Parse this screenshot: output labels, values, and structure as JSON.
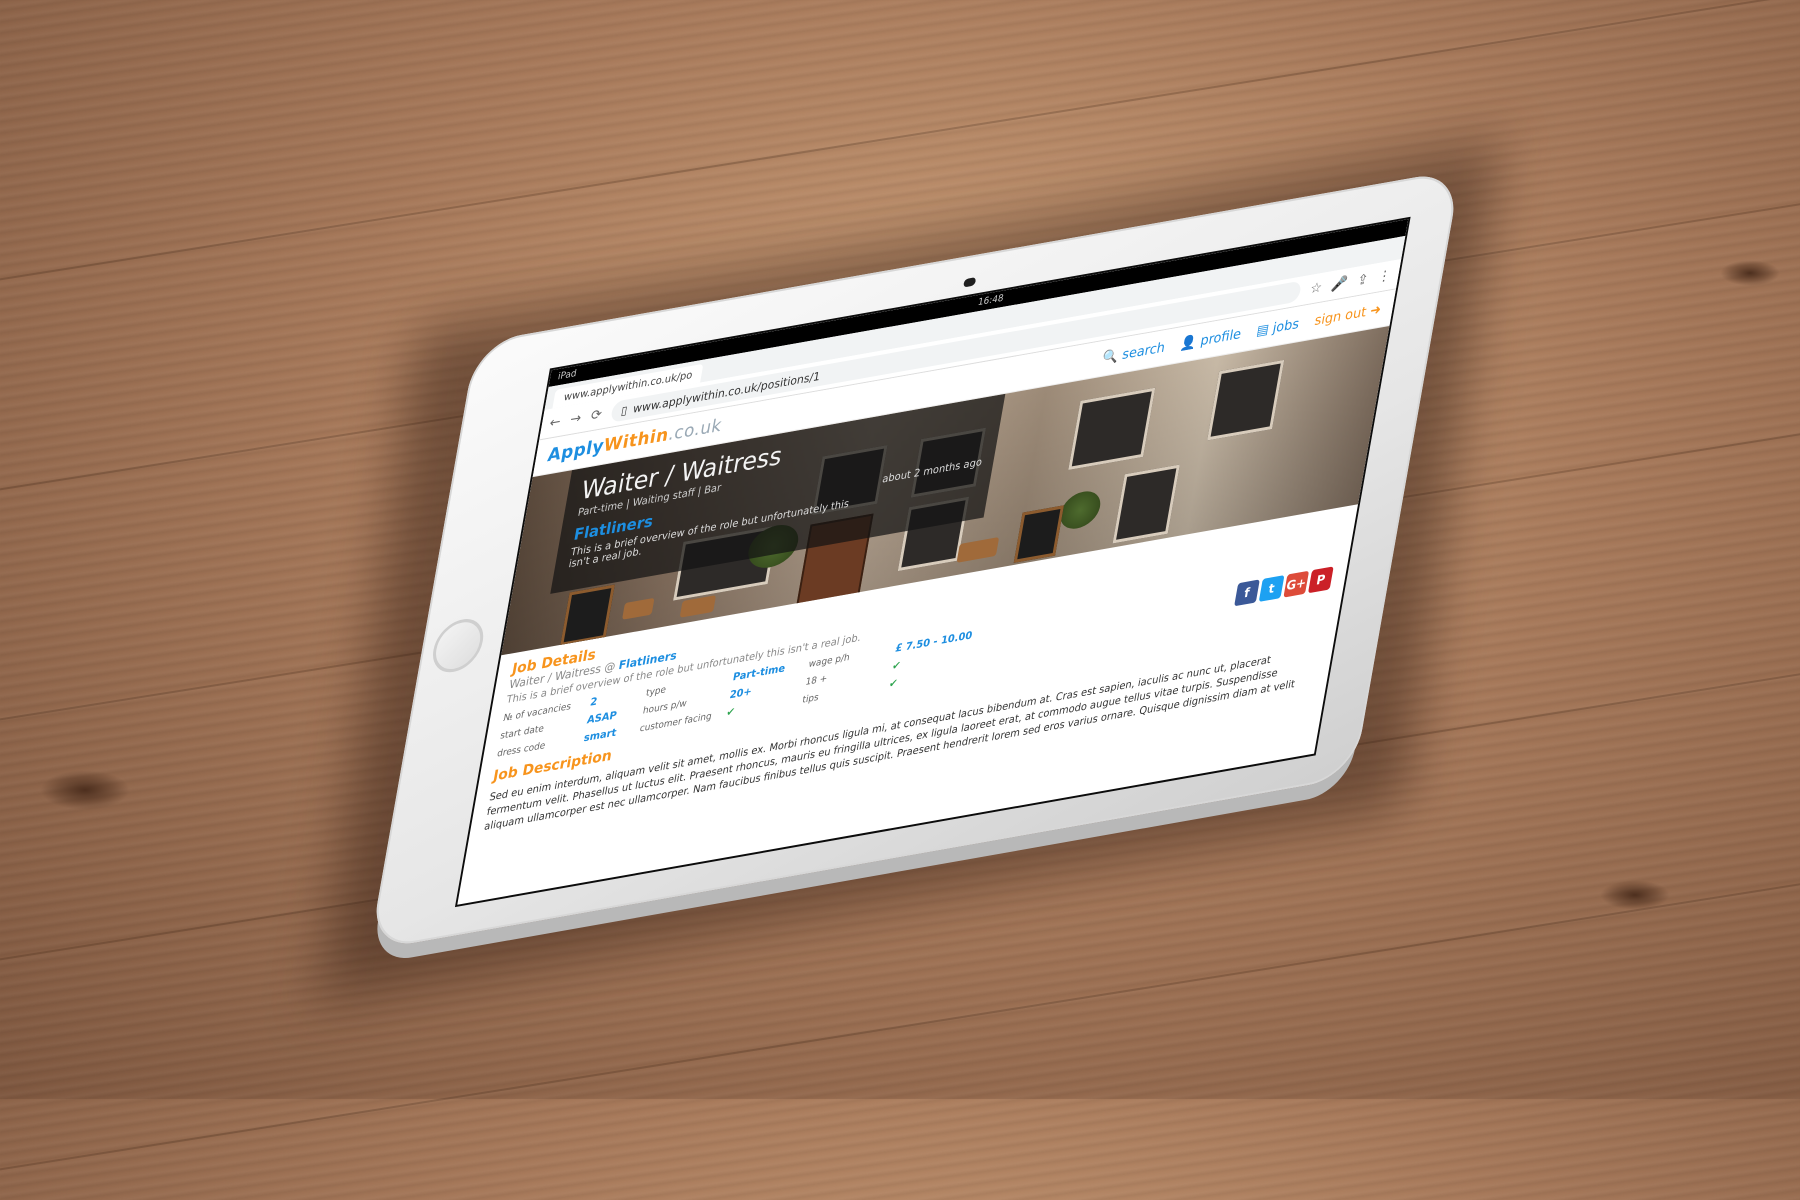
{
  "device": {
    "status_left": "iPad",
    "status_time": "16:48"
  },
  "browser": {
    "tab_title": "www.applywithin.co.uk/po",
    "url": "www.applywithin.co.uk/positions/1"
  },
  "site": {
    "logo_part1": "Apply",
    "logo_part2": "Within",
    "logo_part3": ".co.uk",
    "nav": [
      {
        "label": "search",
        "icon": "search-icon"
      },
      {
        "label": "profile",
        "icon": "user-icon"
      },
      {
        "label": "jobs",
        "icon": "briefcase-icon"
      },
      {
        "label": "sign out",
        "icon": "sign-out-icon"
      }
    ]
  },
  "job": {
    "title": "Waiter / Waitress",
    "meta": "Part-time  |  Waiting staff  |  Bar",
    "company": "Flatliners",
    "posted": "about 2 months ago",
    "overview": "This is a brief overview of the role but unfortunately this isn't a real job."
  },
  "details": {
    "heading": "Job Details",
    "subtitle_role": "Waiter / Waitress @",
    "subtitle_company": "Flatliners",
    "overview": "This is a brief overview of the role but unfortunately this isn't a real job.",
    "fields": [
      {
        "label": "№ of vacancies",
        "value": "2"
      },
      {
        "label": "start date",
        "value": "ASAP"
      },
      {
        "label": "dress code",
        "value": "smart"
      }
    ],
    "fields2": [
      {
        "label": "type",
        "value": "Part-time"
      },
      {
        "label": "hours p/w",
        "value": "20+"
      },
      {
        "label": "customer facing",
        "value": "✔"
      }
    ],
    "fields3": [
      {
        "label": "wage p/h",
        "value": "£ 7.50 - 10.00"
      },
      {
        "label": "18 +",
        "value": "✔"
      },
      {
        "label": "tips",
        "value": "✔"
      }
    ]
  },
  "description": {
    "heading": "Job Description",
    "text": "Sed eu enim interdum, aliquam velit sit amet, mollis ex. Morbi rhoncus ligula mi, at consequat lacus bibendum at. Cras est sapien, iaculis ac nunc ut, placerat fermentum velit. Phasellus ut luctus elit. Praesent rhoncus, mauris eu fringilla ultrices, ex ligula laoreet erat, at commodo augue tellus vitae turpis. Suspendisse aliquam ullamcorper est nec ullamcorper. Nam faucibus finibus tellus quis suscipit. Praesent hendrerit lorem sed eros varius ornare. Quisque dignissim diam at velit"
  },
  "social": [
    {
      "name": "facebook-icon",
      "glyph": "f",
      "color": "#3b5998"
    },
    {
      "name": "twitter-icon",
      "glyph": "t",
      "color": "#1da1f2"
    },
    {
      "name": "google-plus-icon",
      "glyph": "G+",
      "color": "#dd4b39"
    },
    {
      "name": "pinterest-icon",
      "glyph": "P",
      "color": "#cb2027"
    }
  ]
}
